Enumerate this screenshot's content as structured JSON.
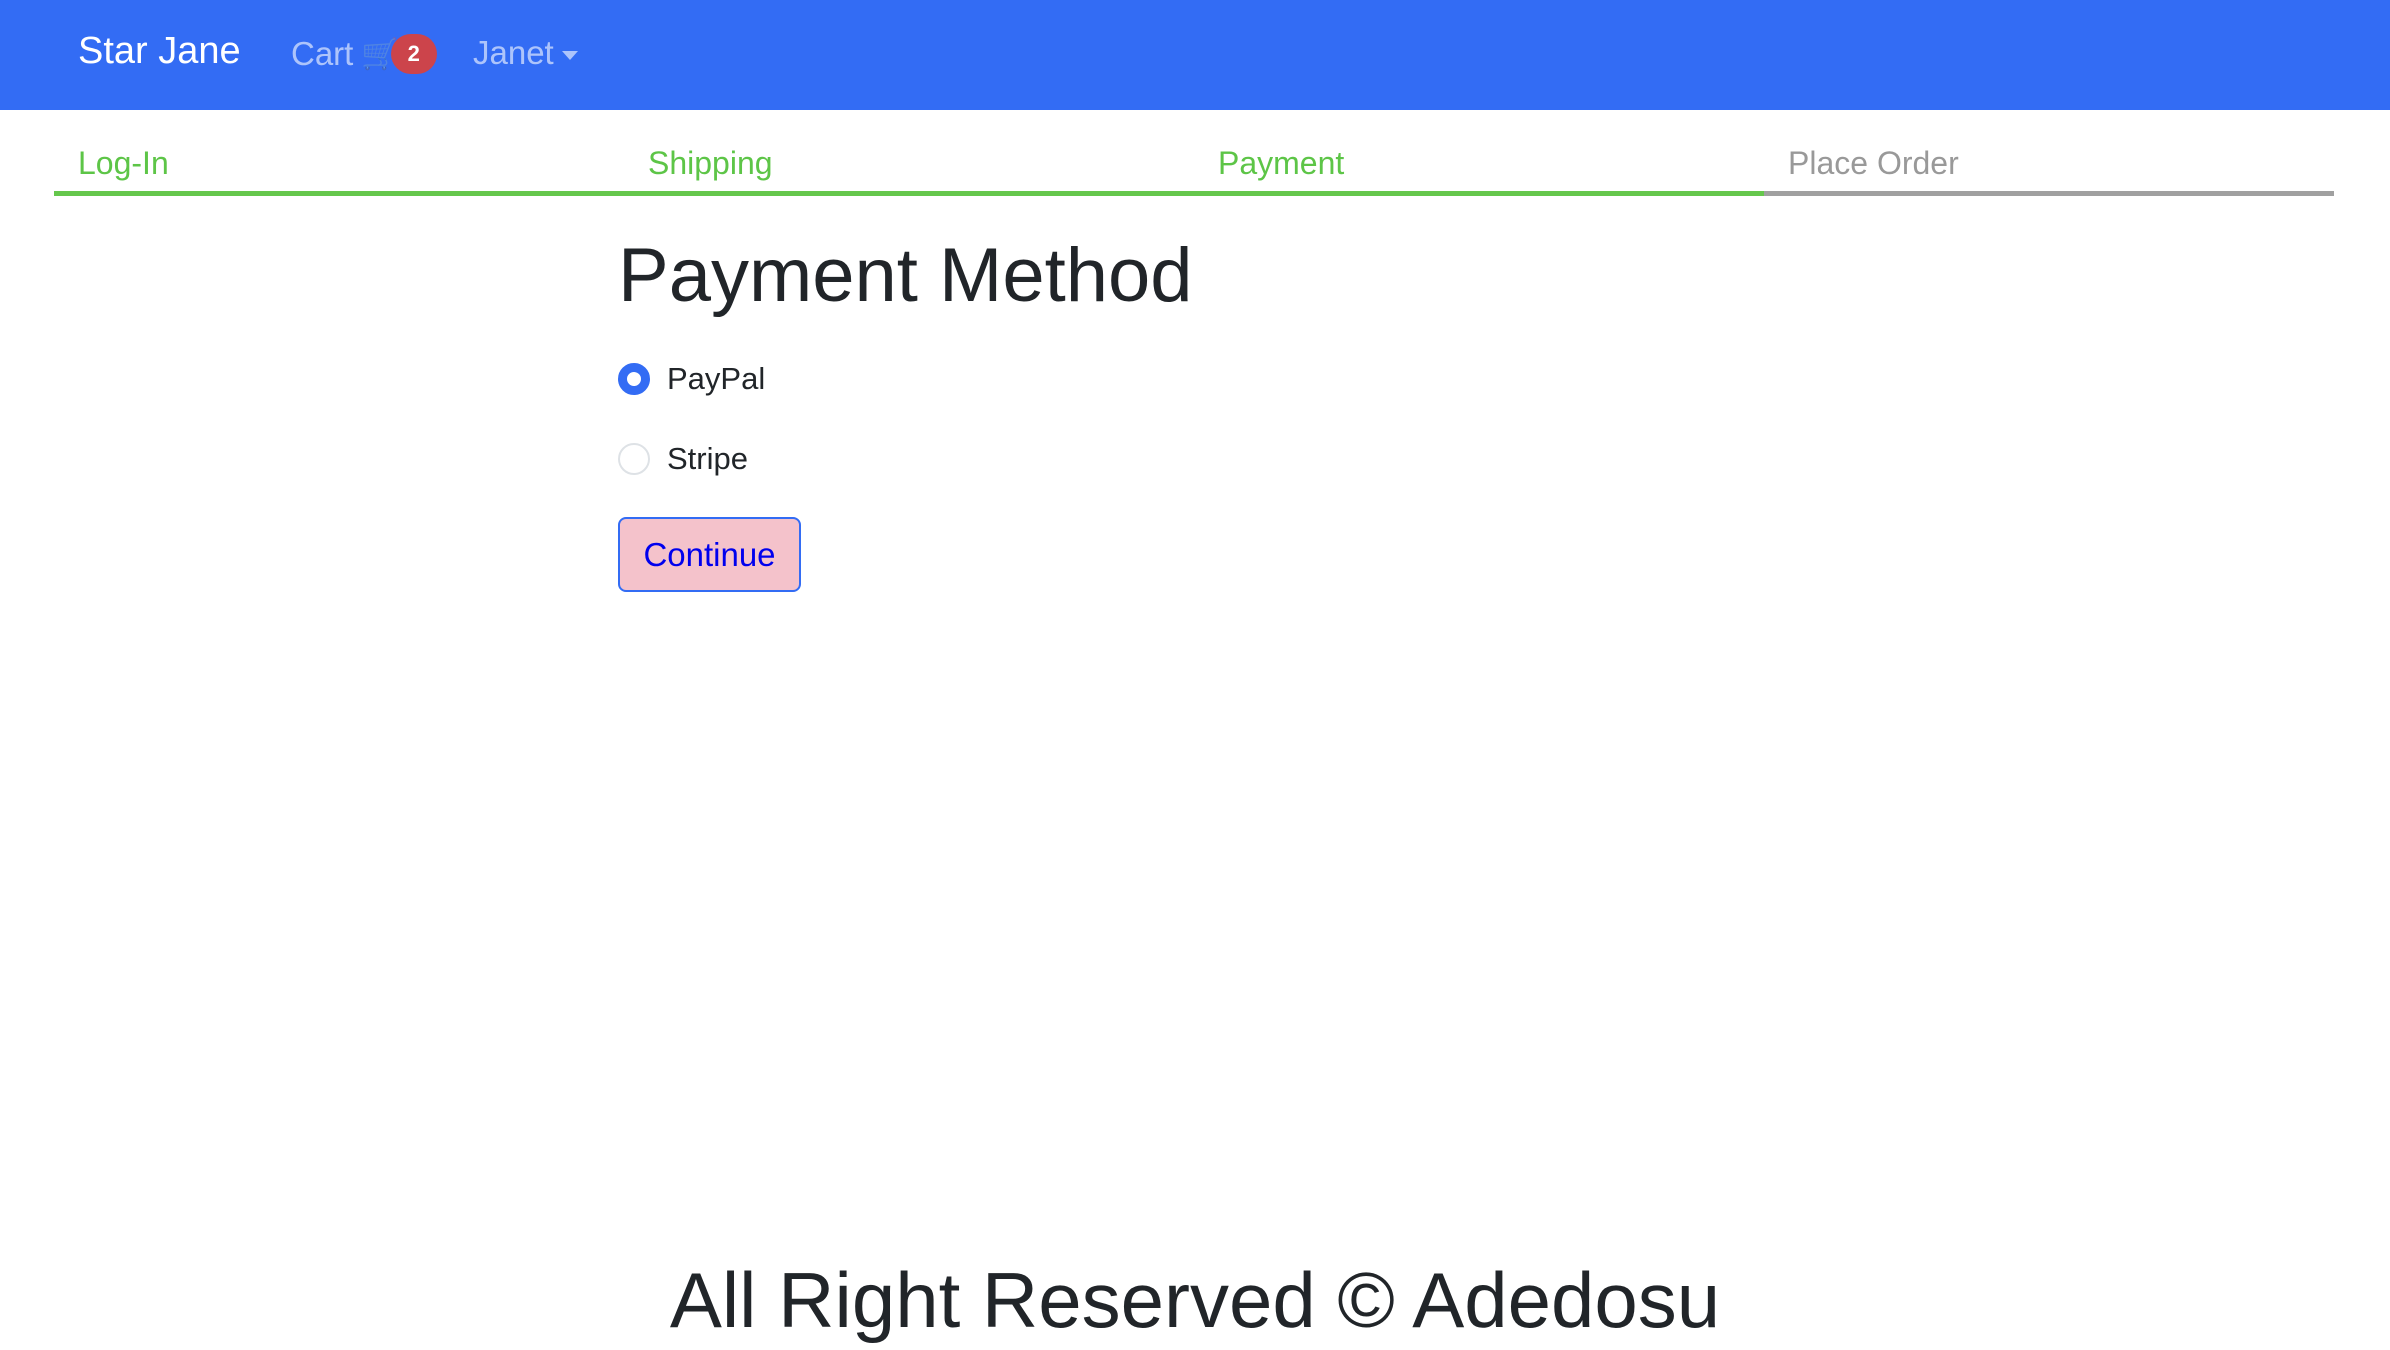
{
  "navbar": {
    "brand": "Star Jane",
    "cart_label": "Cart",
    "cart_icon": "🛒",
    "cart_count": "2",
    "user": "Janet"
  },
  "steps": [
    {
      "label": "Log-In",
      "done": true
    },
    {
      "label": "Shipping",
      "done": true
    },
    {
      "label": "Payment",
      "done": true
    },
    {
      "label": "Place Order",
      "done": false
    }
  ],
  "main": {
    "title": "Payment Method",
    "options": [
      {
        "label": "PayPal",
        "checked": true
      },
      {
        "label": "Stripe",
        "checked": false
      }
    ],
    "continue_label": "Continue"
  },
  "footer": {
    "text": "All Right Reserved © Adedosu"
  },
  "colors": {
    "navbar": "#336cf4",
    "step_done": "#65c74c",
    "badge": "#cc444b",
    "button_bg": "#f4c2cb"
  }
}
